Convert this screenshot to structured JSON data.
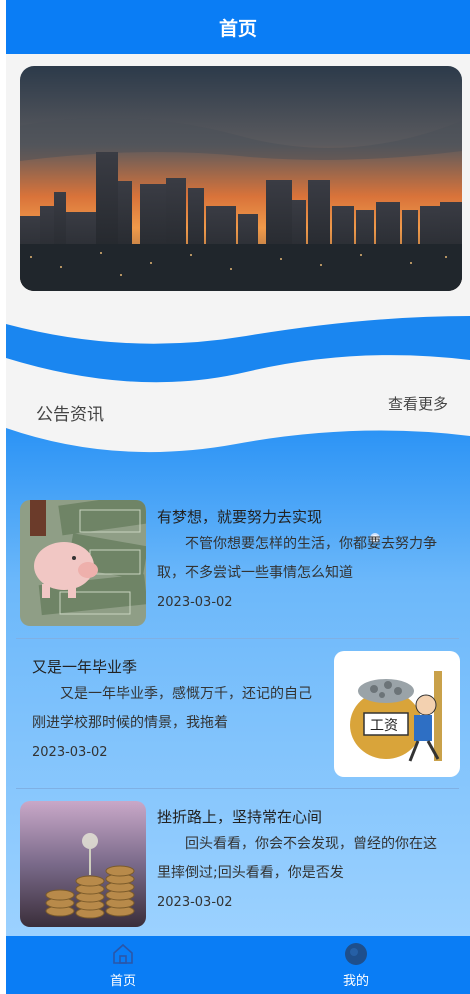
{
  "header": {
    "title": "首页"
  },
  "banner": {
    "image": "city-skyline-sunset"
  },
  "notice": {
    "title": "公告资讯",
    "more_label": "查看更多"
  },
  "news": [
    {
      "title": "有梦想，就要努力去实现",
      "summary": "不管你想要怎样的生活，你都要去努力争取，不多尝试一些事情怎么知道",
      "date": "2023-03-02",
      "thumb": "piggy-bank-money-image"
    },
    {
      "title": "又是一年毕业季",
      "summary": "又是一年毕业季，感慨万千，还记的自己刚进学校那时候的情景，我拖着",
      "date": "2023-03-02",
      "thumb": "salary-bag-cartoon-image"
    },
    {
      "title": "挫折路上，坚持常在心间",
      "summary": "回头看看，你会不会发现，曾经的你在这里摔倒过;回头看看，你是否发",
      "date": "2023-03-02",
      "thumb": "coin-stacks-growth-image"
    }
  ],
  "tabbar": {
    "home_label": "首页",
    "mine_label": "我的"
  },
  "colors": {
    "primary": "#0a7df5",
    "wave_light": "#bfe0ff"
  }
}
